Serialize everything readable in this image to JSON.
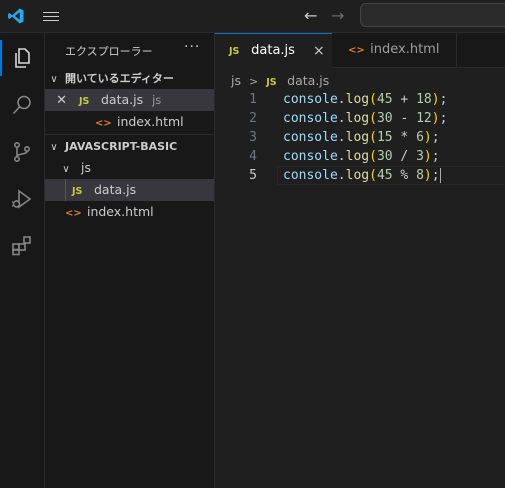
{
  "titlebar": {
    "back_icon": "arrow-left-icon",
    "forward_icon": "arrow-right-icon"
  },
  "activity_bar": {
    "items": [
      "explorer-icon",
      "search-icon",
      "source-control-icon",
      "run-debug-icon",
      "extensions-icon"
    ]
  },
  "sidebar": {
    "title": "エクスプローラー",
    "more": "···",
    "open_editors": {
      "title": "開いているエディター",
      "items": [
        {
          "badge": "JS",
          "name": "data.js",
          "hint": "js"
        },
        {
          "badge": "<>",
          "name": "index.html"
        }
      ]
    },
    "workspace": {
      "title": "JAVASCRIPT-BASIC",
      "folder": "js",
      "items": [
        {
          "badge": "JS",
          "name": "data.js"
        },
        {
          "badge": "<>",
          "name": "index.html"
        }
      ]
    }
  },
  "editor": {
    "tabs": [
      {
        "badge": "JS",
        "label": "data.js",
        "close": "×"
      },
      {
        "badge": "<>",
        "label": "index.html"
      }
    ],
    "breadcrumb": {
      "folder": "js",
      "file_badge": "JS",
      "file": "data.js"
    },
    "lines": [
      {
        "n": "1",
        "obj": "console",
        "fn": "log",
        "a": "45",
        "op": "+",
        "b": "18"
      },
      {
        "n": "2",
        "obj": "console",
        "fn": "log",
        "a": "30",
        "op": "-",
        "b": "12"
      },
      {
        "n": "3",
        "obj": "console",
        "fn": "log",
        "a": "15",
        "op": "*",
        "b": "6"
      },
      {
        "n": "4",
        "obj": "console",
        "fn": "log",
        "a": "30",
        "op": "/",
        "b": "3"
      },
      {
        "n": "5",
        "obj": "console",
        "fn": "log",
        "a": "45",
        "op": "%",
        "b": "8"
      }
    ],
    "current_line": 5
  },
  "colors": {
    "accent": "#0078d4",
    "js_badge": "#cbcb41",
    "html_badge": "#e37933"
  }
}
